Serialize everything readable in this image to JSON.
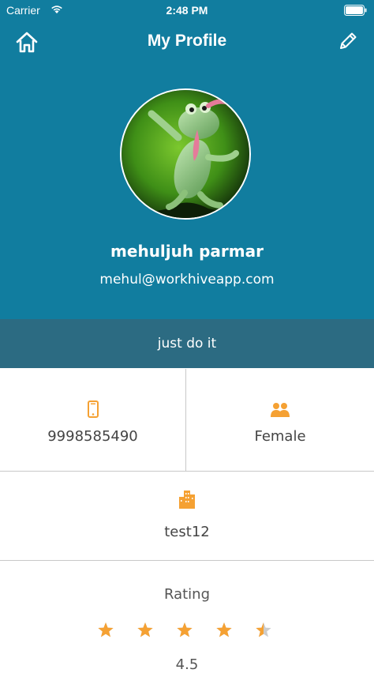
{
  "status_bar": {
    "carrier": "Carrier",
    "time": "2:48 PM"
  },
  "navbar": {
    "title": "My Profile",
    "left_icon": "home-icon",
    "right_icon": "pencil-edit-icon"
  },
  "profile": {
    "name": "mehuljuh parmar",
    "email": "mehul@workhiveapp.com",
    "status": "just do it"
  },
  "details": {
    "phone": {
      "icon": "mobile-phone-icon",
      "value": "9998585490"
    },
    "gender": {
      "icon": "gender-icon",
      "value": "Female"
    },
    "city": {
      "icon": "city-buildings-icon",
      "value": "test12"
    }
  },
  "rating": {
    "label": "Rating",
    "value": 4.5,
    "display_value": "4.5",
    "max": 5
  },
  "colors": {
    "header_bg": "#117d9f",
    "status_strip_bg": "#2c6b82",
    "accent_orange": "#f5a133",
    "star_empty": "#cccccc"
  }
}
